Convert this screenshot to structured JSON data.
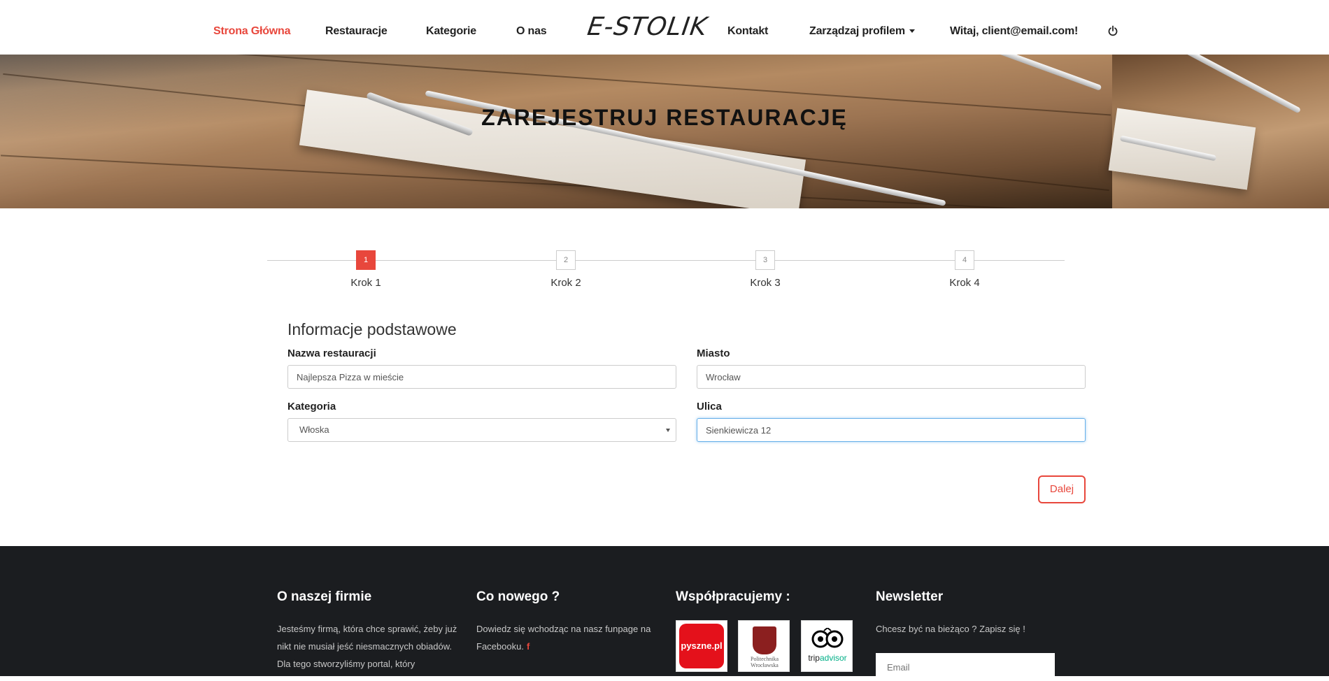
{
  "nav": {
    "items": [
      {
        "label": "Strona Główna",
        "active": true
      },
      {
        "label": "Restauracje"
      },
      {
        "label": "Kategorie"
      },
      {
        "label": "O nas"
      }
    ],
    "logo": "E-STOLIK",
    "items_right": [
      {
        "label": "Kontakt"
      },
      {
        "label": "Zarządzaj profilem"
      },
      {
        "label": "Witaj, client@email.com!"
      }
    ],
    "power_icon": "power-icon"
  },
  "hero": {
    "title": "ZAREJESTRUJ RESTAURACJĘ"
  },
  "steps": [
    {
      "number": "1",
      "label": "Krok 1",
      "active": true
    },
    {
      "number": "2",
      "label": "Krok 2"
    },
    {
      "number": "3",
      "label": "Krok 3"
    },
    {
      "number": "4",
      "label": "Krok 4"
    }
  ],
  "form": {
    "section_title": "Informacje podstawowe",
    "name_label": "Nazwa restauracji",
    "name_value": "Najlepsza Pizza w mieście",
    "city_label": "Miasto",
    "city_value": "Wrocław",
    "category_label": "Kategoria",
    "category_value": "Włoska",
    "street_label": "Ulica",
    "street_value": "Sienkiewicza 12",
    "next_button": "Dalej"
  },
  "footer": {
    "about": {
      "title": "O naszej firmie",
      "text": "Jesteśmy firmą, która chce sprawić, żeby już nikt nie musiał jeść niesmacznych obiadów. Dla tego stworzyliśmy portal, który"
    },
    "news": {
      "title": "Co nowego ?",
      "text": "Dowiedz się wchodząc na nasz funpage na Facebooku.",
      "fb_icon": "f"
    },
    "partners": {
      "title": "Współpracujemy :",
      "items": [
        {
          "name": "pyszne.pl"
        },
        {
          "name": "Politechnika Wrocławska"
        },
        {
          "name": "tripadvisor",
          "prefix": "trip",
          "suffix": "advisor"
        }
      ]
    },
    "newsletter": {
      "title": "Newsletter",
      "text": "Chcesz być na bieżąco ? Zapisz się !",
      "email_placeholder": "Email"
    }
  },
  "colors": {
    "accent": "#e8473c",
    "footer_bg": "#1b1d20",
    "focus": "#66afe9"
  }
}
